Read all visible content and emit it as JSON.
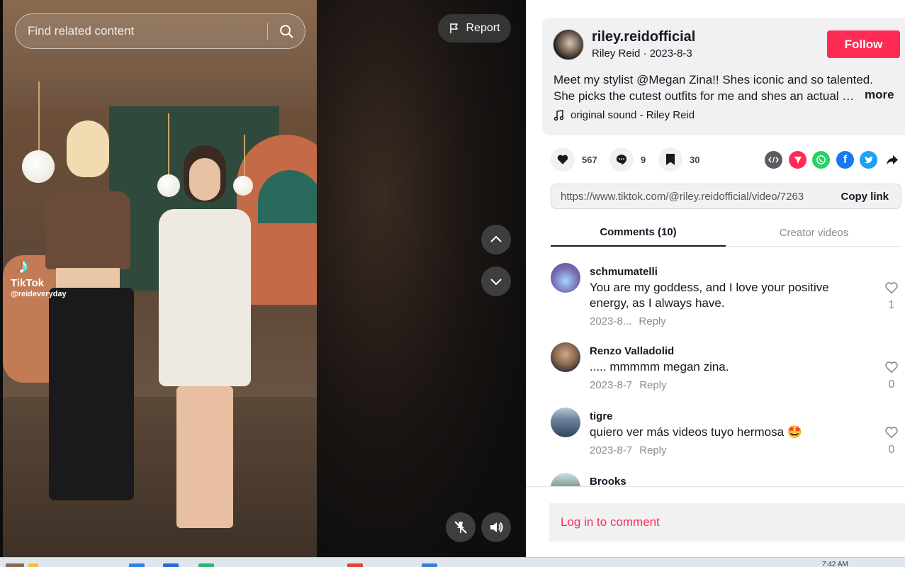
{
  "video": {
    "search_placeholder": "Find related content",
    "report_label": "Report",
    "watermark": {
      "brand": "TikTok",
      "handle": "@reideveryday"
    }
  },
  "author": {
    "username": "riley.reidofficial",
    "display_name": "Riley Reid",
    "date": "2023-8-3",
    "follow_label": "Follow",
    "description_line1": "Meet my stylist @Megan Zina!! Shes iconic and so talented.",
    "description_line2": "She picks the cutest outfits for me and shes an actual angel",
    "more_label": "more",
    "sound": "original sound - Riley Reid"
  },
  "actions": {
    "likes": "567",
    "comments": "9",
    "saves": "30"
  },
  "share": {
    "link": "https://www.tiktok.com/@riley.reidofficial/video/7263",
    "copy_label": "Copy link"
  },
  "tabs": {
    "comments": "Comments (10)",
    "creator_videos": "Creator videos"
  },
  "comments": [
    {
      "user": "schmumatelli",
      "text": "You are my goddess, and I love your positive energy, as I always have.",
      "date": "2023-8...",
      "reply": "Reply",
      "likes": "1",
      "avatar_color": "#7b6ab0"
    },
    {
      "user": "Renzo Valladolid",
      "text": "..... mmmmm megan zina.",
      "date": "2023-8-7",
      "reply": "Reply",
      "likes": "0",
      "avatar_color": "#8b6a52"
    },
    {
      "user": "tigre",
      "text": "quiero ver más videos tuyo hermosa 🤩",
      "date": "2023-8-7",
      "reply": "Reply",
      "likes": "0",
      "avatar_color": "#3b5570"
    },
    {
      "user": "Brooks",
      "text": "",
      "date": "",
      "reply": "",
      "likes": "",
      "avatar_color": "#6f8a7a"
    }
  ],
  "login": {
    "label": "Log in to comment"
  },
  "colors": {
    "accent": "#fe2c55",
    "panel_bg": "#f1f1f2"
  },
  "taskbar": {
    "clock": "7:42 AM"
  }
}
